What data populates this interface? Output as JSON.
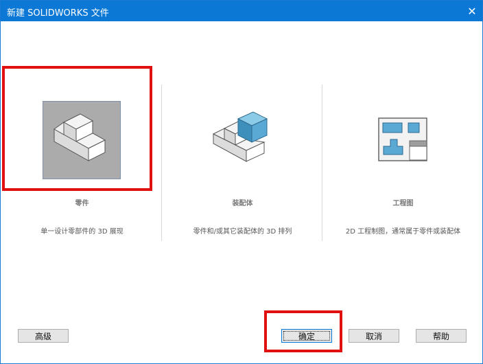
{
  "window": {
    "title": "新建 SOLIDWORKS 文件",
    "close_glyph": "✕"
  },
  "options": [
    {
      "label": "零件",
      "description": "单一设计零部件的 3D 展现",
      "icon": "part-icon"
    },
    {
      "label": "装配体",
      "description": "零件和/或其它装配体的 3D 排列",
      "icon": "assembly-icon"
    },
    {
      "label": "工程图",
      "description": "2D 工程制图，通常属于零件或装配体",
      "icon": "drawing-icon"
    }
  ],
  "buttons": {
    "advanced": "高级",
    "ok": "确定",
    "cancel": "取消",
    "help": "帮助"
  },
  "colors": {
    "titlebar": "#0b78d6",
    "selected_bg": "#ababab",
    "highlight": "#e01010",
    "assembly_blue": "#5aa8d4"
  }
}
